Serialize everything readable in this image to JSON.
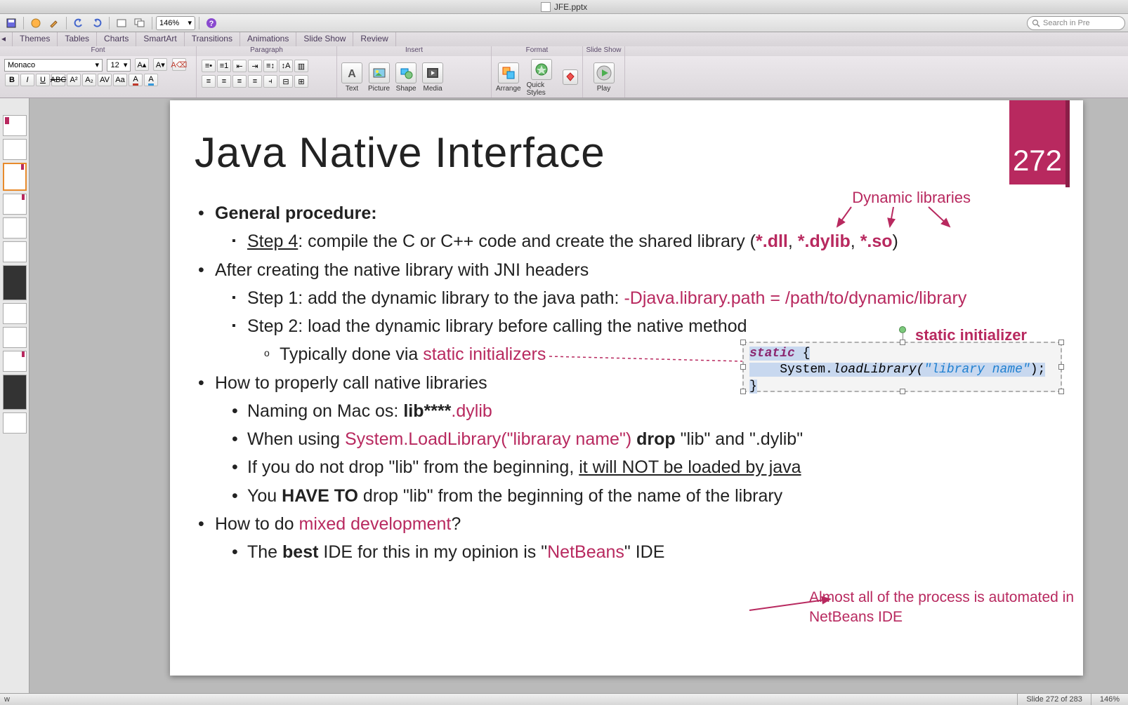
{
  "window": {
    "title": "JFE.pptx"
  },
  "toolbar": {
    "zoom": "146%",
    "search_placeholder": "Search in Pre"
  },
  "ribbon_tabs": [
    "Themes",
    "Tables",
    "Charts",
    "SmartArt",
    "Transitions",
    "Animations",
    "Slide Show",
    "Review"
  ],
  "ribbon_groups": {
    "font": "Font",
    "paragraph": "Paragraph",
    "insert": "Insert",
    "format": "Format",
    "slideshow": "Slide Show"
  },
  "font": {
    "name": "Monaco",
    "size": "12"
  },
  "insert_buttons": {
    "text": "Text",
    "picture": "Picture",
    "shape": "Shape",
    "media": "Media"
  },
  "format_buttons": {
    "arrange": "Arrange",
    "quick": "Quick Styles"
  },
  "slideshow_button": "Play",
  "slide": {
    "title": "Java Native Interface",
    "number": "272",
    "dyn_label": "Dynamic libraries",
    "static_label": "static initializer",
    "auto_note": "Almost all of the process is automated in NetBeans IDE",
    "bullets": {
      "gp": "General procedure:",
      "step4_a": "Step 4",
      "step4_b": ": compile the C or C++ code and create the shared library (",
      "dll": "*.dll",
      "comma1": ", ",
      "dylib": "*.dylib",
      "comma2": ", ",
      "so": "*.so",
      "close": ")",
      "after": "After creating the native library with JNI headers",
      "s1a": "Step 1: add the dynamic library to the java path: ",
      "s1b": "-Djava.library.path = /path/to/dynamic/library",
      "s2": "Step 2: load the dynamic library before calling the native method",
      "typ_a": "Typically done via ",
      "typ_b": "static initializers",
      "howcall": "How to properly call native libraries",
      "naming_a": "Naming on Mac os:   ",
      "naming_b": "lib****",
      "naming_c": ".dylib",
      "when_a": "When using ",
      "when_b": "System.LoadLibrary(\"libraray name\")",
      "when_c": " ",
      "when_d": "drop",
      "when_e": " \"lib\" and \".dylib\"",
      "notdrop_a": "If you do not drop \"lib\" from the beginning, ",
      "notdrop_b": "it will NOT be loaded by java",
      "haveto_a": "You ",
      "haveto_b": "HAVE TO",
      "haveto_c": " drop \"lib\" from the beginning of the name of the library",
      "mixed_a": "How to do ",
      "mixed_b": "mixed development",
      "mixed_c": "?",
      "best_a": "The ",
      "best_b": "best",
      "best_c": " IDE for this in my opinion is \"",
      "best_d": "NetBeans",
      "best_e": "\" IDE"
    },
    "code": {
      "l1a": "static",
      "l1b": " {",
      "l2a": "    System.",
      "l2b": "loadLibrary(",
      "l2c": "\"library name\"",
      "l2d": ");",
      "l3": "}"
    }
  },
  "status": {
    "slide_pos": "Slide 272 of 283",
    "zoom": "146%"
  }
}
